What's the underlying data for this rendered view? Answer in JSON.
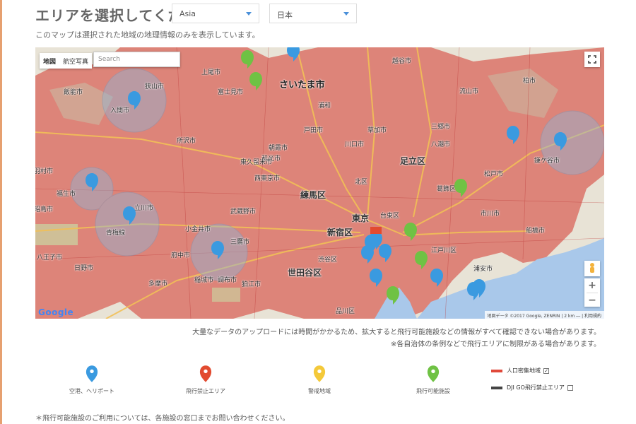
{
  "header": {
    "title": "エリアを選択してください",
    "region_select": "Asia",
    "country_select": "日本",
    "subtitle": "このマップは選択された地域の地理情報のみを表示しています。"
  },
  "map": {
    "type_tabs": [
      "地図",
      "航空写真"
    ],
    "search_placeholder": "Search",
    "google_logo": "Google",
    "attribution": "地図データ ©2017 Google, ZENRIN | 2 km ⎯⎯ | 利用規約",
    "labels": {
      "saitama": "さいたま市",
      "adachi": "足立区",
      "nerima": "練馬区",
      "tokyo": "東京",
      "shinjuku": "新宿区",
      "setagaya": "世田谷区",
      "kawaguchi": "川口市",
      "tokorozawa": "所沢市",
      "iruma": "入間市",
      "hamura": "羽村市",
      "fussa": "福生市",
      "oume": "青梅線",
      "akishima": "昭島市",
      "hachioji": "八王子市",
      "tachikawa": "立川市",
      "fuchu": "府中市",
      "mitaka": "三鷹市",
      "musashino": "武蔵野市",
      "koganei": "小金井市",
      "kitaku": "北区",
      "taito": "台東区",
      "katsushika": "葛飾区",
      "edogawa": "江戸川区",
      "ichikawa": "市川市",
      "matsudo": "松戸市",
      "kamagaya": "鎌ケ谷市",
      "funabashi": "船橋市",
      "urayasu": "浦安市",
      "shibuya": "渋谷区",
      "shinagawa": "品川区",
      "koshigaya": "越谷市",
      "kashiwa": "柏市",
      "ageo": "上尾市",
      "fujimi": "富士見市",
      "asaka": "朝霞市",
      "wako": "和光市",
      "nerima2": "西東京市",
      "higashikurume": "東久留米市",
      "hanno": "飯能市",
      "sayama": "狭山市",
      "tama": "多摩市",
      "inagi": "稲城市",
      "chofu": "調布市",
      "komae": "狛江市",
      "hino": "日野市",
      "misato": "三郷市",
      "yashio": "八潮市",
      "soka": "草加市",
      "nagareyama": "流山市",
      "urawa": "浦和",
      "toda": "戸田市"
    }
  },
  "notices": {
    "line1": "大量なデータのアップロードには時間がかかるため、拡大すると飛行可能施設などの情報がすべて確認できない場合があります。",
    "line2": "※各自治体の条例などで飛行エリアに制限がある場合があります。"
  },
  "legend": {
    "airport": "空港、ヘリポート",
    "no_fly": "飛行禁止エリア",
    "caution": "警戒地域",
    "allowed": "飛行可能施設",
    "dense_area": "人口密集地域",
    "dji_no_fly": "DJI GO飛行禁止エリア",
    "dense_checked": true,
    "dji_checked": false,
    "colors": {
      "airport": "#3a9ae0",
      "no_fly": "#e24b30",
      "caution": "#f4c93a",
      "allowed": "#6fc244",
      "dense": "#e0493a",
      "dji": "#444444"
    }
  },
  "footer_note": "＊飛行可能施設のご利用については、各施設の窓口までお問い合わせください。"
}
